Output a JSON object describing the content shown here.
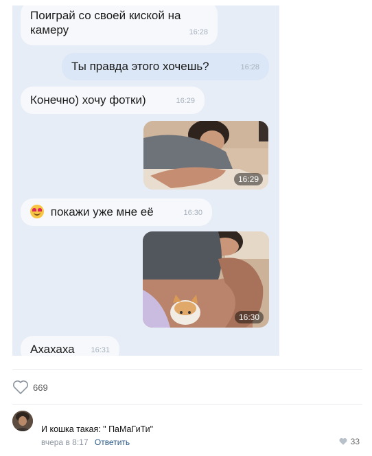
{
  "chat": {
    "messages": [
      {
        "text_line1": "Поиграй со своей киской на",
        "text_line2": "камеру",
        "time": "16:28"
      },
      {
        "text": "Ты правда этого хочешь?",
        "time": "16:28"
      },
      {
        "text": "Конечно) хочу фотки)",
        "time": "16:29"
      },
      {
        "photo_time": "16:29"
      },
      {
        "emoji": "heart-eyes-emoji",
        "text": "покажи уже мне её",
        "time": "16:30"
      },
      {
        "photo_time": "16:30"
      },
      {
        "text": "Ахахаха",
        "time": "16:31"
      }
    ]
  },
  "post": {
    "likes": "669"
  },
  "comment": {
    "text": "И кошка такая: \" ПаМаГиТи\"",
    "date": "вчера в 8:17",
    "reply_label": "Ответить",
    "likes": "33"
  },
  "colors": {
    "incoming": "#f6f8fb",
    "outgoing": "#dbe7f6",
    "link": "#2a5885"
  }
}
